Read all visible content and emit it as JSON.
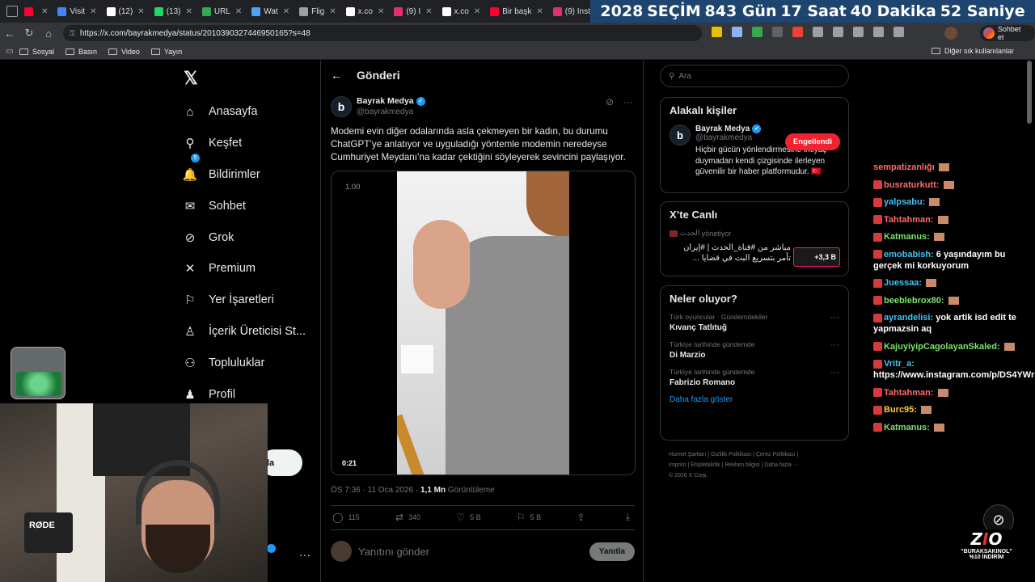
{
  "browser": {
    "tabs": [
      {
        "label": "",
        "color": "#ff0033"
      },
      {
        "label": "Visit",
        "color": "#4285f4"
      },
      {
        "label": "(12)",
        "color": "#ffffff"
      },
      {
        "label": "(13)",
        "color": "#25d366"
      },
      {
        "label": "URL",
        "color": "#34a853"
      },
      {
        "label": "Wat",
        "color": "#4fa3f7"
      },
      {
        "label": "Flig",
        "color": "#9aa0a6"
      },
      {
        "label": "x.co",
        "color": "#ffffff"
      },
      {
        "label": "(9) I",
        "color": "#e1306c"
      },
      {
        "label": "x.co",
        "color": "#ffffff"
      },
      {
        "label": "Bir başk",
        "color": "#ff0033"
      },
      {
        "label": "(9) Insta",
        "color": "#e1306c"
      },
      {
        "label": "x.com/",
        "color": "#ffffff"
      }
    ],
    "url": "https://x.com/bayrakmedya/status/2010390327446950165?s=48",
    "chat_button": "Sohbet et",
    "bookmarks": [
      "Sosyal",
      "Basın",
      "Video",
      "Yayın"
    ],
    "bookmarks_other": "Diğer sık kullanılanlar"
  },
  "countdown": [
    "2028",
    "SEÇİM",
    "843 Gün",
    "17 Saat",
    "40 Dakika",
    "52 Saniye"
  ],
  "nav": {
    "items": [
      {
        "label": "Anasayfa",
        "icon": "home-icon",
        "glyph": "⌂"
      },
      {
        "label": "Keşfet",
        "icon": "search-icon",
        "glyph": "⚲"
      },
      {
        "label": "Bildirimler",
        "icon": "bell-icon",
        "glyph": "🔔"
      },
      {
        "label": "Sohbet",
        "icon": "mail-icon",
        "glyph": "✉"
      },
      {
        "label": "Grok",
        "icon": "grok-icon",
        "glyph": "⊘"
      },
      {
        "label": "Premium",
        "icon": "x-icon",
        "glyph": "✕"
      },
      {
        "label": "Yer İşaretleri",
        "icon": "bookmark-icon",
        "glyph": "⚐"
      },
      {
        "label": "İçerik Üreticisi St...",
        "icon": "creator-icon",
        "glyph": "♙"
      },
      {
        "label": "Topluluklar",
        "icon": "communities-icon",
        "glyph": "⚇"
      },
      {
        "label": "Profil",
        "icon": "profile-icon",
        "glyph": "♟"
      }
    ],
    "notif_badge": "5",
    "post_button": "la"
  },
  "post": {
    "header": "Gönderi",
    "author_name": "Bayrak Medya",
    "author_handle": "@bayrakmedya",
    "text": "Modemi evin diğer odalarında asla çekmeyen bir kadın, bu durumu ChatGPT’ye anlatıyor ve uyguladığı yöntemle modemin neredeyse Cumhuriyet Meydanı’na kadar çektiğini söyleyerek sevincini paylaşıyor.",
    "video_speed": "1.00",
    "video_time": "0:21",
    "timestamp": "ÖS 7:36 · 11 Oca 2026 · ",
    "views_count": "1,1 Mn",
    "views_label": " Görüntüleme",
    "replies": "115",
    "reposts": "340",
    "likes": "5 B",
    "bookmarks": "5 B",
    "reply_placeholder": "Yanıtını gönder",
    "reply_button": "Yanıtla"
  },
  "sidebar": {
    "search_placeholder": "Ara",
    "people_title": "Alakalı kişiler",
    "person_name": "Bayrak Medya",
    "person_handle": "@bayrakmedya",
    "person_bio": "Hiçbir gücün yönlendirmesine ihtiyaç duymadan kendi çizgisinde ilerleyen güvenilir bir haber platformudur. 🇹🇷",
    "blocked_label": "Engellendi",
    "live_title": "X’te Canlı",
    "live_source": "الحدث",
    "live_role": "yönetiyor",
    "live_text": "مباشر من #قناة_الحدث | #إيران تأمر بتسريع البت في قضايا ...",
    "live_count": "+3,3 B",
    "trends_title": "Neler oluyor?",
    "trends": [
      {
        "context": "Türk oyuncular · Gündemdekiler",
        "title": "Kıvanç Tatlıtuğ"
      },
      {
        "context": "Türkiye tarihinde gündemde",
        "title": "Di Marzio"
      },
      {
        "context": "Türkiye tarihinde gündemde",
        "title": "Fabrizio Romano"
      }
    ],
    "show_more": "Daha fazla göster",
    "footer1": "Hizmet Şartları  |  Gizlilik Politikası  |  Çerez Politikası  |",
    "footer2": "Imprint  |  Erişilebilirlik  |  Reklam bilgisi  |  Daha fazla ···",
    "footer3": "© 2026 X Corp."
  },
  "chat": [
    {
      "user": "sempatizanlığı",
      "msg": "",
      "color": "red"
    },
    {
      "user": "busraturkutt:",
      "msg": "",
      "color": "red"
    },
    {
      "user": "yalpsabu:",
      "msg": "",
      "color": "blue"
    },
    {
      "user": "Tahtahman:",
      "msg": "",
      "color": "red"
    },
    {
      "user": "Katmanus:",
      "msg": "",
      "color": "green"
    },
    {
      "user": "emobabish:",
      "msg": "6 yaşındayım bu gerçek mi korkuyorum",
      "color": "blue"
    },
    {
      "user": "Juessaa:",
      "msg": "",
      "color": "blue"
    },
    {
      "user": "beeblebrox80:",
      "msg": "",
      "color": "green"
    },
    {
      "user": "ayrandelisi:",
      "msg": "yok artik isd edit te yapmazsin aq",
      "color": "blue"
    },
    {
      "user": "KajuyiyipCagolayanSkaled:",
      "msg": "",
      "color": "green"
    },
    {
      "user": "Vritr_a:",
      "msg": "https://www.instagram.com/p/DS4YWr3CO63/",
      "color": "blue"
    },
    {
      "user": "Tahtahman:",
      "msg": "",
      "color": "red"
    },
    {
      "user": "Burc95:",
      "msg": "",
      "color": "yel"
    },
    {
      "user": "Katmanus:",
      "msg": "",
      "color": "green"
    }
  ],
  "webcam": {
    "mic_label": "RØDE"
  },
  "brand": {
    "line1": "“BURAKSAKINOL”",
    "line2": "%10 İNDİRİM"
  }
}
